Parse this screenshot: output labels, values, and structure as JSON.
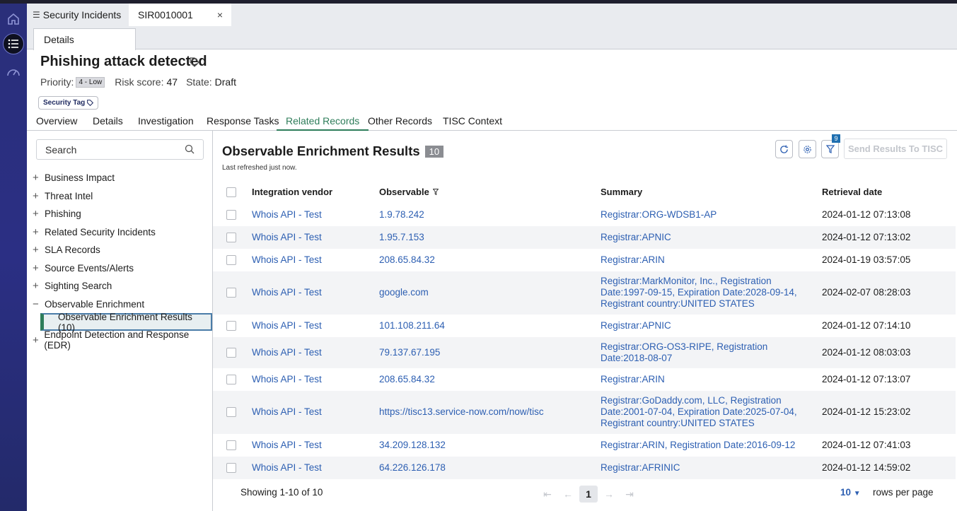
{
  "tabs": [
    {
      "label": "Security Incidents"
    },
    {
      "label": "SIR0010001",
      "close": "×"
    }
  ],
  "subtab": "Details",
  "record": {
    "title": "Phishing attack detected",
    "priority_label": "Priority:",
    "priority_value": "4 - Low",
    "risk_label": "Risk score:",
    "risk_value": "47",
    "state_label": "State:",
    "state_value": "Draft",
    "tag": "Security Tag"
  },
  "nav_tabs": [
    "Overview",
    "Details",
    "Investigation",
    "Response Tasks",
    "Related Records",
    "Other Records",
    "TISC Context"
  ],
  "active_nav": "Related Records",
  "sidebar": {
    "search_placeholder": "Search",
    "items": [
      {
        "label": "Business Impact",
        "expanded": false
      },
      {
        "label": "Threat Intel",
        "expanded": false
      },
      {
        "label": "Phishing",
        "expanded": false
      },
      {
        "label": "Related Security Incidents",
        "expanded": false
      },
      {
        "label": "SLA Records",
        "expanded": false
      },
      {
        "label": "Source Events/Alerts",
        "expanded": false
      },
      {
        "label": "Sighting Search",
        "expanded": false
      },
      {
        "label": "Observable Enrichment",
        "expanded": true
      },
      {
        "label": "Endpoint Detection and Response (EDR)",
        "expanded": false
      }
    ],
    "selected_child": "Observable Enrichment Results (10)"
  },
  "results": {
    "title": "Observable Enrichment Results",
    "count": "10",
    "refreshed": "Last refreshed just now.",
    "filter_count": "9",
    "send_button": "Send Results To TISC",
    "columns": [
      "Integration vendor",
      "Observable",
      "Summary",
      "Retrieval date"
    ],
    "rows": [
      {
        "vendor": "Whois API - Test",
        "observable": "1.9.78.242",
        "summary": "Registrar:ORG-WDSB1-AP",
        "date": "2024-01-12 07:13:08"
      },
      {
        "vendor": "Whois API - Test",
        "observable": "1.95.7.153",
        "summary": "Registrar:APNIC",
        "date": "2024-01-12 07:13:02"
      },
      {
        "vendor": "Whois API - Test",
        "observable": "208.65.84.32",
        "summary": "Registrar:ARIN",
        "date": "2024-01-19 03:57:05"
      },
      {
        "vendor": "Whois API - Test",
        "observable": "google.com",
        "summary": "Registrar:MarkMonitor, Inc., Registration Date:1997-09-15, Expiration Date:2028-09-14, Registrant country:UNITED STATES",
        "date": "2024-02-07 08:28:03"
      },
      {
        "vendor": "Whois API - Test",
        "observable": "101.108.211.64",
        "summary": "Registrar:APNIC",
        "date": "2024-01-12 07:14:10"
      },
      {
        "vendor": "Whois API - Test",
        "observable": "79.137.67.195",
        "summary": "Registrar:ORG-OS3-RIPE, Registration Date:2018-08-07",
        "date": "2024-01-12 08:03:03"
      },
      {
        "vendor": "Whois API - Test",
        "observable": "208.65.84.32",
        "summary": "Registrar:ARIN",
        "date": "2024-01-12 07:13:07"
      },
      {
        "vendor": "Whois API - Test",
        "observable": "https://tisc13.service-now.com/now/tisc",
        "summary": "Registrar:GoDaddy.com, LLC, Registration Date:2001-07-04, Expiration Date:2025-07-04, Registrant country:UNITED STATES",
        "date": "2024-01-12 15:23:02"
      },
      {
        "vendor": "Whois API - Test",
        "observable": "34.209.128.132",
        "summary": "Registrar:ARIN, Registration Date:2016-09-12",
        "date": "2024-01-12 07:41:03"
      },
      {
        "vendor": "Whois API - Test",
        "observable": "64.226.126.178",
        "summary": "Registrar:AFRINIC",
        "date": "2024-01-12 14:59:02"
      }
    ],
    "showing": "Showing 1-10 of 10",
    "page": "1",
    "rows_per_page_value": "10",
    "rows_per_page_label": "rows per page"
  }
}
